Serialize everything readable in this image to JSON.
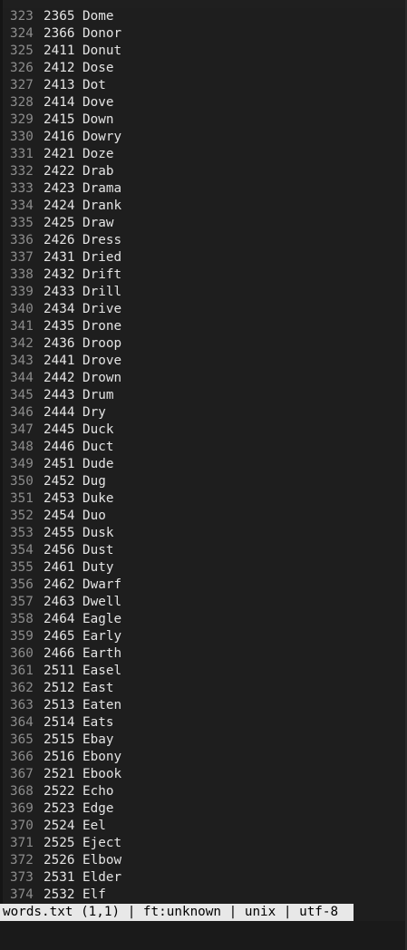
{
  "buffer": {
    "lines": [
      {
        "num": "323",
        "text": "2365 Dome"
      },
      {
        "num": "324",
        "text": "2366 Donor"
      },
      {
        "num": "325",
        "text": "2411 Donut"
      },
      {
        "num": "326",
        "text": "2412 Dose"
      },
      {
        "num": "327",
        "text": "2413 Dot"
      },
      {
        "num": "328",
        "text": "2414 Dove"
      },
      {
        "num": "329",
        "text": "2415 Down"
      },
      {
        "num": "330",
        "text": "2416 Dowry"
      },
      {
        "num": "331",
        "text": "2421 Doze"
      },
      {
        "num": "332",
        "text": "2422 Drab"
      },
      {
        "num": "333",
        "text": "2423 Drama"
      },
      {
        "num": "334",
        "text": "2424 Drank"
      },
      {
        "num": "335",
        "text": "2425 Draw"
      },
      {
        "num": "336",
        "text": "2426 Dress"
      },
      {
        "num": "337",
        "text": "2431 Dried"
      },
      {
        "num": "338",
        "text": "2432 Drift"
      },
      {
        "num": "339",
        "text": "2433 Drill"
      },
      {
        "num": "340",
        "text": "2434 Drive"
      },
      {
        "num": "341",
        "text": "2435 Drone"
      },
      {
        "num": "342",
        "text": "2436 Droop"
      },
      {
        "num": "343",
        "text": "2441 Drove"
      },
      {
        "num": "344",
        "text": "2442 Drown"
      },
      {
        "num": "345",
        "text": "2443 Drum"
      },
      {
        "num": "346",
        "text": "2444 Dry"
      },
      {
        "num": "347",
        "text": "2445 Duck"
      },
      {
        "num": "348",
        "text": "2446 Duct"
      },
      {
        "num": "349",
        "text": "2451 Dude"
      },
      {
        "num": "350",
        "text": "2452 Dug"
      },
      {
        "num": "351",
        "text": "2453 Duke"
      },
      {
        "num": "352",
        "text": "2454 Duo"
      },
      {
        "num": "353",
        "text": "2455 Dusk"
      },
      {
        "num": "354",
        "text": "2456 Dust"
      },
      {
        "num": "355",
        "text": "2461 Duty"
      },
      {
        "num": "356",
        "text": "2462 Dwarf"
      },
      {
        "num": "357",
        "text": "2463 Dwell"
      },
      {
        "num": "358",
        "text": "2464 Eagle"
      },
      {
        "num": "359",
        "text": "2465 Early"
      },
      {
        "num": "360",
        "text": "2466 Earth"
      },
      {
        "num": "361",
        "text": "2511 Easel"
      },
      {
        "num": "362",
        "text": "2512 East"
      },
      {
        "num": "363",
        "text": "2513 Eaten"
      },
      {
        "num": "364",
        "text": "2514 Eats"
      },
      {
        "num": "365",
        "text": "2515 Ebay"
      },
      {
        "num": "366",
        "text": "2516 Ebony"
      },
      {
        "num": "367",
        "text": "2521 Ebook"
      },
      {
        "num": "368",
        "text": "2522 Echo"
      },
      {
        "num": "369",
        "text": "2523 Edge"
      },
      {
        "num": "370",
        "text": "2524 Eel"
      },
      {
        "num": "371",
        "text": "2525 Eject"
      },
      {
        "num": "372",
        "text": "2526 Elbow"
      },
      {
        "num": "373",
        "text": "2531 Elder"
      },
      {
        "num": "374",
        "text": "2532 Elf"
      }
    ]
  },
  "statusline": {
    "text": "words.txt (1,1) | ft:unknown | unix | utf-8"
  },
  "colors": {
    "background": "#1e1e1e",
    "line_number": "#8c8c8c",
    "text": "#e4e4e4",
    "statusline_bg": "#e8e8e8",
    "statusline_fg": "#000000"
  }
}
